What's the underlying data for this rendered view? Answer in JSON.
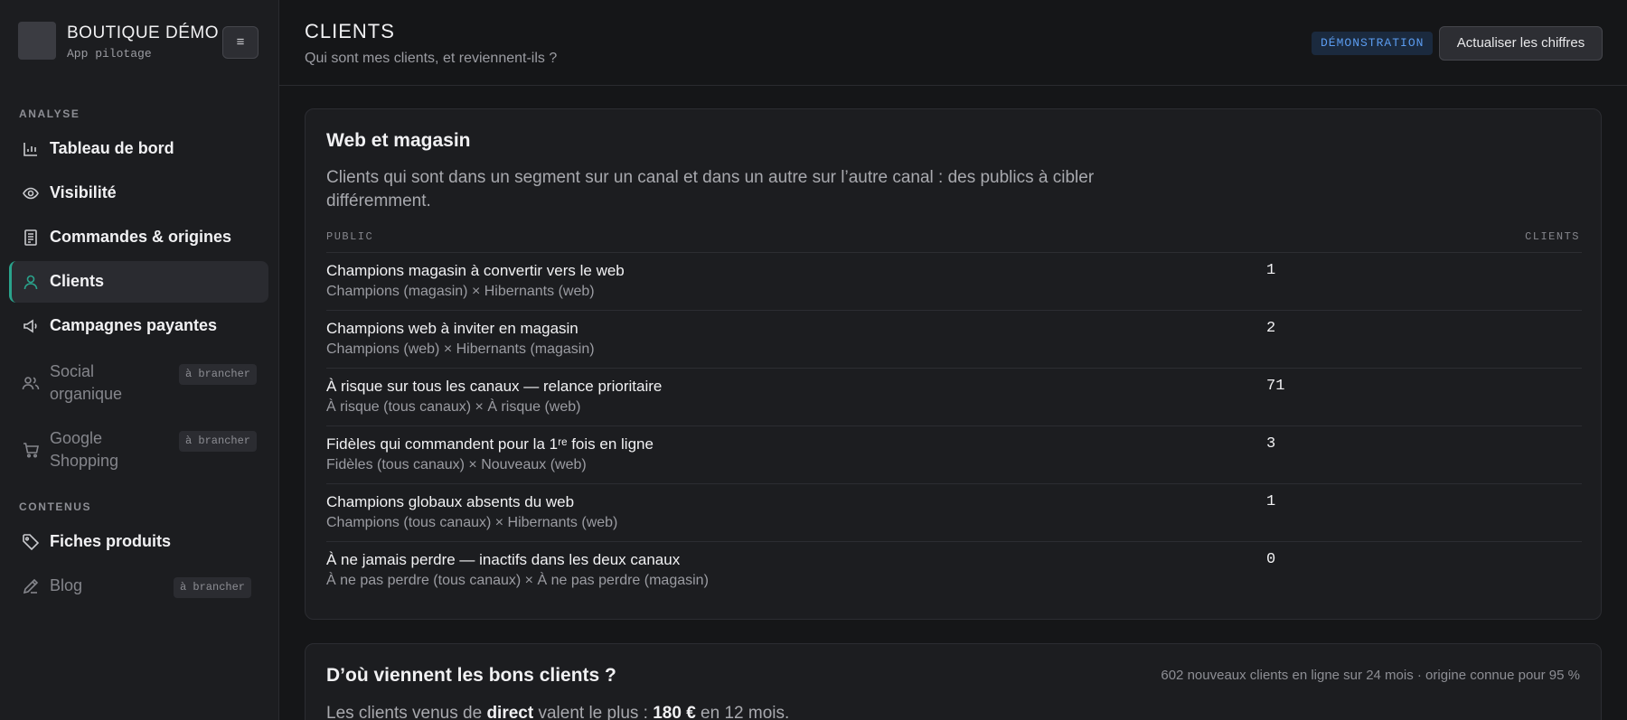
{
  "brand": {
    "name": "BOUTIQUE DÉMO",
    "subtitle": "App pilotage",
    "menu_icon": "hamburger-icon"
  },
  "sidebar": {
    "sections": [
      {
        "title": "ANALYSE"
      },
      {
        "title": "CONTENUS"
      }
    ],
    "items": [
      {
        "label": "Tableau de bord",
        "icon": "bar-chart-icon"
      },
      {
        "label": "Visibilité",
        "icon": "eye-icon"
      },
      {
        "label": "Commandes & origines",
        "icon": "receipt-icon"
      },
      {
        "label": "Clients",
        "icon": "user-icon",
        "active": true
      },
      {
        "label": "Campagnes payantes",
        "icon": "megaphone-icon"
      },
      {
        "label": "Social organique",
        "icon": "users-icon",
        "badge": "à brancher"
      },
      {
        "label": "Google Shopping",
        "icon": "cart-icon",
        "badge": "à brancher"
      },
      {
        "label": "Fiches produits",
        "icon": "tag-icon"
      },
      {
        "label": "Blog",
        "icon": "pen-icon",
        "badge": "à brancher"
      }
    ]
  },
  "header": {
    "title": "CLIENTS",
    "subtitle": "Qui sont mes clients, et reviennent-ils ?",
    "badge": "DÉMONSTRATION",
    "refresh_label": "Actualiser les chiffres"
  },
  "card1": {
    "title": "Web et magasin",
    "description": "Clients qui sont dans un segment sur un canal et dans un autre sur l’autre canal : des publics à cibler différemment.",
    "columns": {
      "public": "PUBLIC",
      "clients": "CLIENTS"
    },
    "rows": [
      {
        "title": "Champions magasin à convertir vers le web",
        "sub": "Champions (magasin) × Hibernants (web)",
        "count": "1"
      },
      {
        "title": "Champions web à inviter en magasin",
        "sub": "Champions (web) × Hibernants (magasin)",
        "count": "2"
      },
      {
        "title": "À risque sur tous les canaux — relance prioritaire",
        "sub": "À risque (tous canaux) × À risque (web)",
        "count": "71"
      },
      {
        "title": "Fidèles qui commandent pour la 1ʳᵉ fois en ligne",
        "sub": "Fidèles (tous canaux) × Nouveaux (web)",
        "count": "3"
      },
      {
        "title": "Champions globaux absents du web",
        "sub": "Champions (tous canaux) × Hibernants (web)",
        "count": "1"
      },
      {
        "title": "À ne jamais perdre — inactifs dans les deux canaux",
        "sub": "À ne pas perdre (tous canaux) × À ne pas perdre (magasin)",
        "count": "0"
      }
    ]
  },
  "card2": {
    "title": "D’où viennent les bons clients ?",
    "meta": "602 nouveaux clients en ligne sur 24 mois · origine connue pour 95 %",
    "text_prefix": "Les clients venus de ",
    "text_channel": "direct",
    "text_middle": " valent le plus : ",
    "text_value": "180 €",
    "text_suffix": " en 12 mois."
  },
  "colors": {
    "accent": "#2aa38c",
    "badge_text": "#5b9cf0",
    "background": "#151618"
  }
}
